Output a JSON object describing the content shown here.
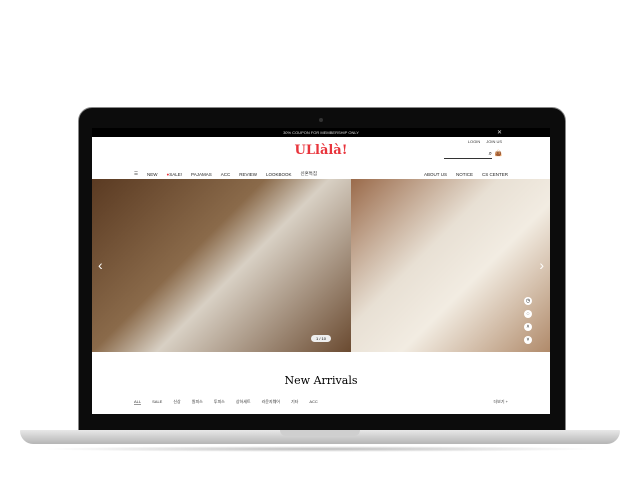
{
  "topbar": {
    "text": "30% COUPON FOR MEMBERSHIP ONLY",
    "close": "✕"
  },
  "header": {
    "logo": "ULlàlà!",
    "login": "LOGIN",
    "join": "JOIN US"
  },
  "nav": {
    "items": [
      "NEW",
      "SALE!",
      "PAJAMAS",
      "ACC",
      "REVIEW",
      "LOOKBOOK",
      "신혼특집"
    ],
    "right": [
      "ABOUT US",
      "NOTICE",
      "CS CENTER"
    ]
  },
  "hero": {
    "counter": "1 / 10"
  },
  "section": {
    "title": "New Arrivals",
    "tabs": [
      "ALL",
      "SALE",
      "신상",
      "원피스",
      "투피스",
      "상하세트",
      "라운지웨어",
      "기타",
      "ACC"
    ],
    "more": "더보기 +"
  }
}
